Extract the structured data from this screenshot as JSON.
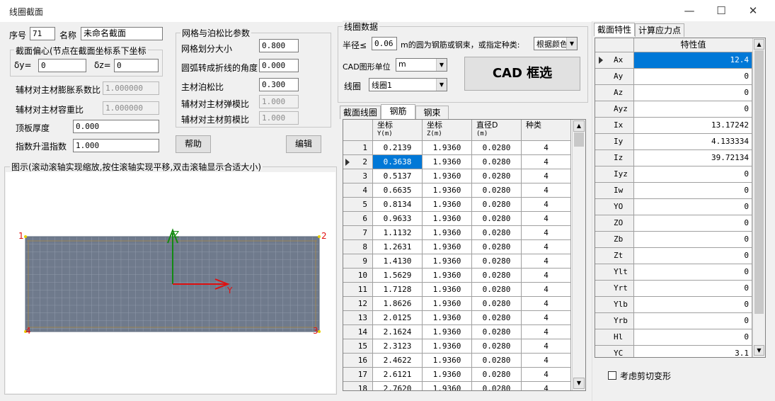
{
  "window": {
    "title": "线圈截面"
  },
  "left": {
    "seq_label": "序号",
    "seq_value": "71",
    "name_label": "名称",
    "name_value": "未命名截面",
    "offset_group": "截面偏心(节点在截面坐标系下坐标",
    "dy_label": "δy=",
    "dy_value": "0",
    "dz_label": "δz=",
    "dz_value": "0",
    "thermal_label": "辅材对主材膨胀系数比",
    "thermal_value": "1.000000",
    "weight_label": "辅材对主材容重比",
    "weight_value": "1.000000",
    "plate_label": "顶板厚度",
    "plate_value": "0.000",
    "temp_label": "指数升温指数",
    "temp_value": "1.000"
  },
  "mesh": {
    "group_title": "网格与泊松比参数",
    "mesh_size_label": "网格划分大小",
    "mesh_size_value": "0.800",
    "arc_label": "圆弧转成折线的角度",
    "arc_value": "0.000",
    "poisson_label": "主材泊松比",
    "poisson_value": "0.300",
    "elastic_label": "辅材对主材弹模比",
    "elastic_value": "1.000",
    "shear_label": "辅材对主材剪模比",
    "shear_value": "1.000",
    "help_button": "帮助",
    "edit_button": "编辑"
  },
  "figure": {
    "group_title": "图示(滚动滚轴实现缩放,按住滚轴实现平移,双击滚轴显示合适大小)",
    "axis_z": "Z",
    "axis_y": "Y",
    "corner_labels": [
      "1",
      "2",
      "3",
      "4"
    ]
  },
  "coil": {
    "group_title": "线圈数据",
    "radius_prefix": "半径≤",
    "radius_value": "0.06",
    "radius_suffix": "m的圆为钢筋或钢束，或指定种类:",
    "kind_value": "根据颜色",
    "cad_unit_label": "CAD图形单位",
    "cad_unit_value": "m",
    "coil_label": "线圈",
    "coil_value": "线圈1",
    "cad_button": "CAD 框选"
  },
  "tabs": [
    "截面线圈",
    "钢筋",
    "钢束"
  ],
  "rebar_table": {
    "columns": [
      {
        "top": "坐标",
        "bottom": "Y(m)"
      },
      {
        "top": "坐标",
        "bottom": "Z(m)"
      },
      {
        "top": "直径D",
        "bottom": "(m)"
      },
      {
        "top": "种类",
        "bottom": ""
      }
    ],
    "rows": [
      [
        "1",
        "0.2139",
        "1.9360",
        "0.0280",
        "4"
      ],
      [
        "2",
        "0.3638",
        "1.9360",
        "0.0280",
        "4"
      ],
      [
        "3",
        "0.5137",
        "1.9360",
        "0.0280",
        "4"
      ],
      [
        "4",
        "0.6635",
        "1.9360",
        "0.0280",
        "4"
      ],
      [
        "5",
        "0.8134",
        "1.9360",
        "0.0280",
        "4"
      ],
      [
        "6",
        "0.9633",
        "1.9360",
        "0.0280",
        "4"
      ],
      [
        "7",
        "1.1132",
        "1.9360",
        "0.0280",
        "4"
      ],
      [
        "8",
        "1.2631",
        "1.9360",
        "0.0280",
        "4"
      ],
      [
        "9",
        "1.4130",
        "1.9360",
        "0.0280",
        "4"
      ],
      [
        "10",
        "1.5629",
        "1.9360",
        "0.0280",
        "4"
      ],
      [
        "11",
        "1.7128",
        "1.9360",
        "0.0280",
        "4"
      ],
      [
        "12",
        "1.8626",
        "1.9360",
        "0.0280",
        "4"
      ],
      [
        "13",
        "2.0125",
        "1.9360",
        "0.0280",
        "4"
      ],
      [
        "14",
        "2.1624",
        "1.9360",
        "0.0280",
        "4"
      ],
      [
        "15",
        "2.3123",
        "1.9360",
        "0.0280",
        "4"
      ],
      [
        "16",
        "2.4622",
        "1.9360",
        "0.0280",
        "4"
      ],
      [
        "17",
        "2.6121",
        "1.9360",
        "0.0280",
        "4"
      ],
      [
        "18",
        "2.7620",
        "1.9360",
        "0.0280",
        "4"
      ]
    ],
    "selected_row": 1
  },
  "props": {
    "tabs": [
      "截面特性",
      "计算应力点"
    ],
    "header": "特性值",
    "rows": [
      [
        "Ax",
        "12.4"
      ],
      [
        "Ay",
        "0"
      ],
      [
        "Az",
        "0"
      ],
      [
        "Ayz",
        "0"
      ],
      [
        "Ix",
        "13.17242"
      ],
      [
        "Iy",
        "4.133334"
      ],
      [
        "Iz",
        "39.72134"
      ],
      [
        "Iyz",
        "0"
      ],
      [
        "Iw",
        "0"
      ],
      [
        "YO",
        "0"
      ],
      [
        "ZO",
        "0"
      ],
      [
        "Zb",
        "0"
      ],
      [
        "Zt",
        "0"
      ],
      [
        "Ylt",
        "0"
      ],
      [
        "Yrt",
        "0"
      ],
      [
        "Ylb",
        "0"
      ],
      [
        "Yrb",
        "0"
      ],
      [
        "Hl",
        "0"
      ],
      [
        "YC",
        "3.1"
      ]
    ],
    "selected_row": 0,
    "shear_checkbox": "考虑剪切变形"
  }
}
